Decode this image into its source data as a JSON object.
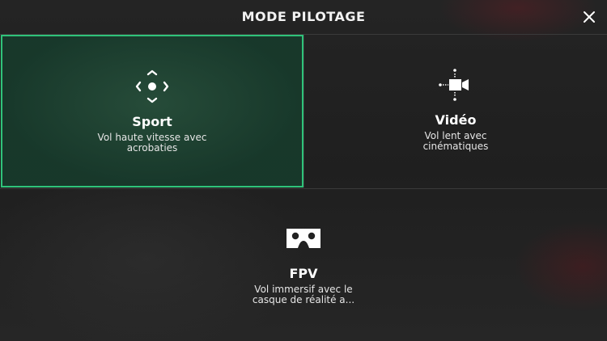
{
  "header": {
    "title": "MODE PILOTAGE"
  },
  "modes": [
    {
      "id": "sport",
      "label": "Sport",
      "description": "Vol haute vitesse avec acrobaties",
      "icon": "move-arrows-icon",
      "selected": true
    },
    {
      "id": "video",
      "label": "Vidéo",
      "description": "Vol lent avec cinématiques",
      "icon": "camera-icon",
      "selected": false
    },
    {
      "id": "fpv",
      "label": "FPV",
      "description": "Vol immersif avec le casque de réalité a...",
      "icon": "vr-headset-icon",
      "selected": false
    }
  ],
  "colors": {
    "accent": "#2fc37a",
    "selected_fill": "#1e4a35",
    "background": "#1e1e1e"
  }
}
